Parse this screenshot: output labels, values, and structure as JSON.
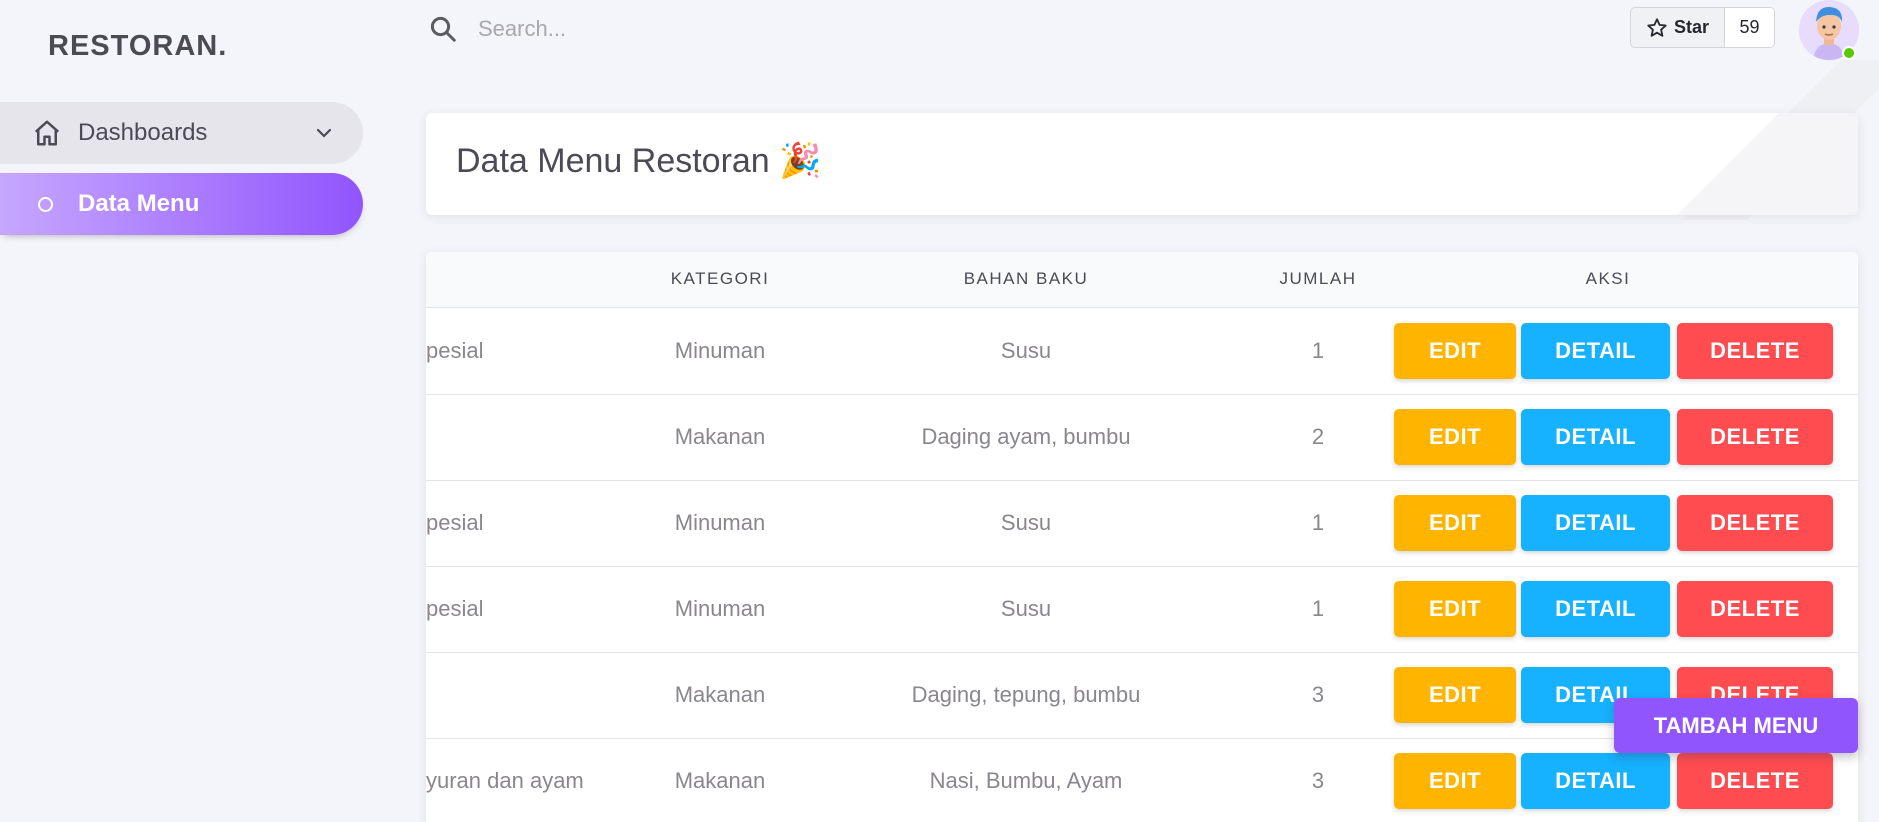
{
  "brand": "RESTORAN.",
  "sidebar": {
    "items": [
      {
        "label": "Dashboards"
      },
      {
        "label": "Data Menu"
      }
    ]
  },
  "search": {
    "placeholder": "Search..."
  },
  "github": {
    "star_label": "Star",
    "star_count": "59"
  },
  "page": {
    "title": "Data Menu Restoran 🎉"
  },
  "table": {
    "headers": [
      "KATEGORI",
      "BAHAN BAKU",
      "JUMLAH",
      "AKSI"
    ],
    "rows": [
      {
        "name": "pesial",
        "kategori": "Minuman",
        "bahan": "Susu",
        "jumlah": "1"
      },
      {
        "name": "",
        "kategori": "Makanan",
        "bahan": "Daging ayam, bumbu",
        "jumlah": "2"
      },
      {
        "name": "pesial",
        "kategori": "Minuman",
        "bahan": "Susu",
        "jumlah": "1"
      },
      {
        "name": "pesial",
        "kategori": "Minuman",
        "bahan": "Susu",
        "jumlah": "1"
      },
      {
        "name": "",
        "kategori": "Makanan",
        "bahan": "Daging, tepung, bumbu",
        "jumlah": "3"
      },
      {
        "name": "yuran dan ayam",
        "kategori": "Makanan",
        "bahan": "Nasi, Bumbu, Ayam",
        "jumlah": "3"
      }
    ],
    "actions": {
      "edit": "EDIT",
      "detail": "DETAIL",
      "delete": "DELETE"
    }
  },
  "fab": {
    "label": "TAMBAH MENU"
  },
  "colors": {
    "primary": "#9155fd",
    "edit": "#ffb400",
    "detail": "#16b1ff",
    "delete": "#ff4c51"
  }
}
